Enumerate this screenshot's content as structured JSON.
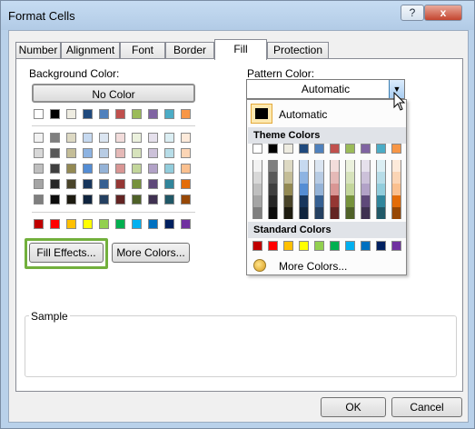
{
  "window": {
    "title": "Format Cells",
    "help_label": "?",
    "close_label": "x"
  },
  "tabs": [
    {
      "label": "Number"
    },
    {
      "label": "Alignment"
    },
    {
      "label": "Font"
    },
    {
      "label": "Border"
    },
    {
      "label": "Fill"
    },
    {
      "label": "Protection"
    }
  ],
  "background": {
    "label": "Background Color:",
    "no_color_label": "No Color",
    "theme_top_row": [
      "#ffffff",
      "#000000",
      "#eeece1",
      "#1f497d",
      "#4f81bd",
      "#c0504d",
      "#9bbb59",
      "#8064a2",
      "#4bacc6",
      "#f79646"
    ],
    "shade_rows": [
      [
        "#f2f2f2",
        "#7f7f7f",
        "#ddd9c3",
        "#c6d9f0",
        "#dbe5f1",
        "#f2dcdb",
        "#ebf1dd",
        "#e5e0ec",
        "#dbeef3",
        "#fdeada"
      ],
      [
        "#d8d8d8",
        "#595959",
        "#c4bd97",
        "#8db3e2",
        "#b8cce4",
        "#e5b9b7",
        "#d7e3bc",
        "#ccc1d9",
        "#b7dde8",
        "#fbd5b5"
      ],
      [
        "#bfbfbf",
        "#3f3f3f",
        "#938953",
        "#548dd4",
        "#95b3d7",
        "#d99694",
        "#c3d69b",
        "#b2a2c7",
        "#92cddc",
        "#fac08f"
      ],
      [
        "#a5a5a5",
        "#262626",
        "#494429",
        "#17365d",
        "#366092",
        "#953734",
        "#76923c",
        "#5f497a",
        "#31859b",
        "#e36c09"
      ],
      [
        "#7f7f7f",
        "#0c0c0c",
        "#1d1b10",
        "#0f243e",
        "#244061",
        "#632423",
        "#4f6128",
        "#3f3151",
        "#205867",
        "#974806"
      ]
    ],
    "standard_row": [
      "#c00000",
      "#ff0000",
      "#ffc000",
      "#ffff00",
      "#92d050",
      "#00b050",
      "#00b0f0",
      "#0070c0",
      "#002060",
      "#7030a0"
    ],
    "fill_effects_label": "Fill Effects...",
    "more_colors_label": "More Colors..."
  },
  "pattern": {
    "label": "Pattern Color:",
    "value": "Automatic",
    "popup": {
      "automatic_label": "Automatic",
      "theme_colors_header": "Theme Colors",
      "standard_colors_header": "Standard Colors",
      "more_colors_label": "More Colors..."
    }
  },
  "sample": {
    "label": "Sample"
  },
  "footer": {
    "ok_label": "OK",
    "cancel_label": "Cancel"
  }
}
